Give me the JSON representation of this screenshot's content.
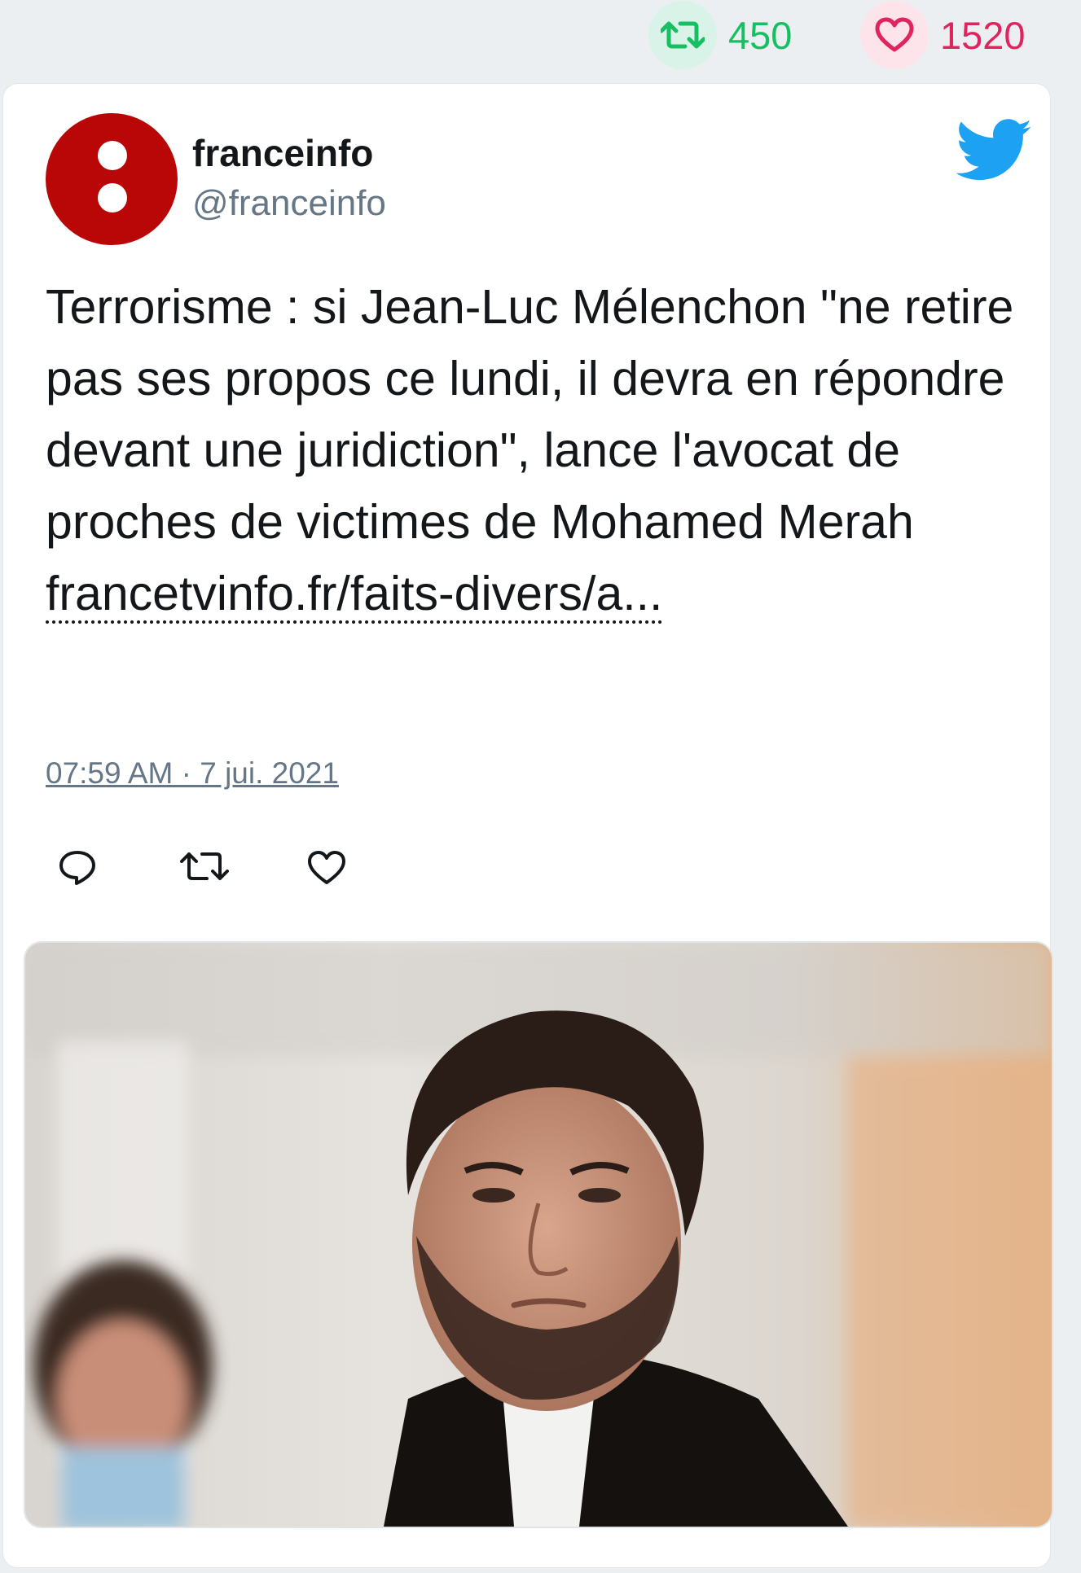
{
  "stats": {
    "retweets": "450",
    "likes": "1520",
    "retweet_icon": "retweet-icon",
    "like_icon": "heart-icon"
  },
  "tweet": {
    "author_name": "franceinfo",
    "author_handle": "@franceinfo",
    "avatar_color": "#b90708",
    "platform_icon": "twitter-bird-icon",
    "text": "Terrorisme : si Jean-Luc Mélenchon \"ne retire pas ses propos ce lundi, il devra en répondre devant une juridiction\", lance l'avocat de proches de victimes de Mohamed Merah ",
    "link_text": "francetvinfo.fr/faits-divers/a...",
    "timestamp": "07:59 AM · 7 jui. 2021"
  },
  "actions": [
    {
      "name": "reply",
      "icon": "reply-icon"
    },
    {
      "name": "retweet",
      "icon": "retweet-icon"
    },
    {
      "name": "like",
      "icon": "heart-icon"
    }
  ],
  "colors": {
    "retweet_green": "#17bf63",
    "like_red": "#e0245e",
    "twitter_blue": "#1da1f2",
    "muted": "#657786"
  }
}
